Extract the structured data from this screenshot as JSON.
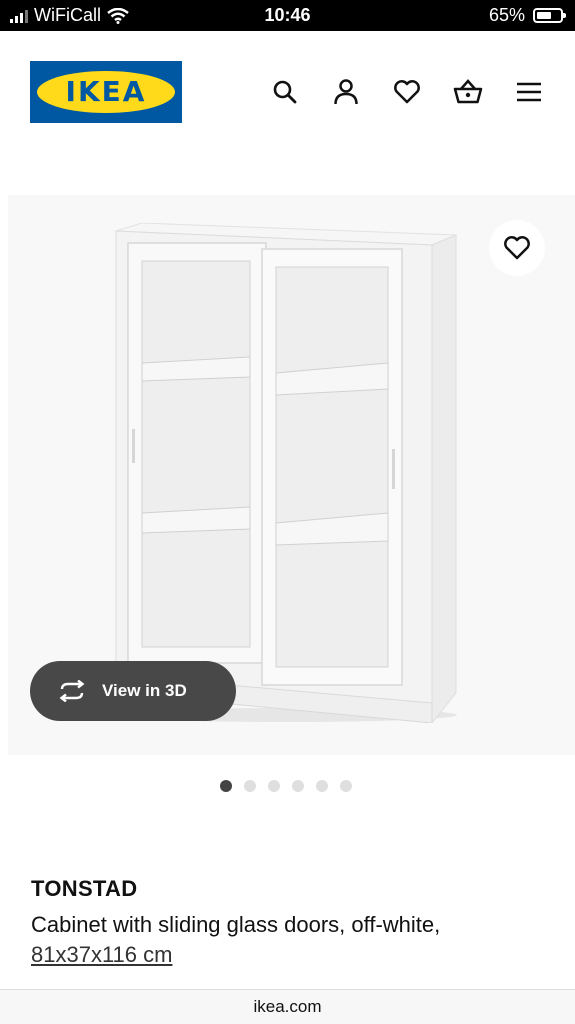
{
  "status": {
    "carrier": "WiFiCall",
    "time": "10:46",
    "battery": "65%",
    "battery_level": 0.65
  },
  "header": {
    "logo_text": "IKEA",
    "icons": [
      "search-icon",
      "account-icon",
      "wishlist-icon",
      "cart-icon",
      "menu-icon"
    ]
  },
  "gallery": {
    "view_3d_label": "View in 3D",
    "dots_count": 6,
    "active_index": 0
  },
  "product": {
    "name": "TONSTAD",
    "description": "Cabinet with sliding glass doors, off-white,",
    "size": "81x37x116 cm"
  },
  "browser": {
    "url": "ikea.com"
  },
  "colors": {
    "ikea_blue": "#0058a3",
    "ikea_yellow": "#ffda1a",
    "button_dark": "#484848"
  }
}
